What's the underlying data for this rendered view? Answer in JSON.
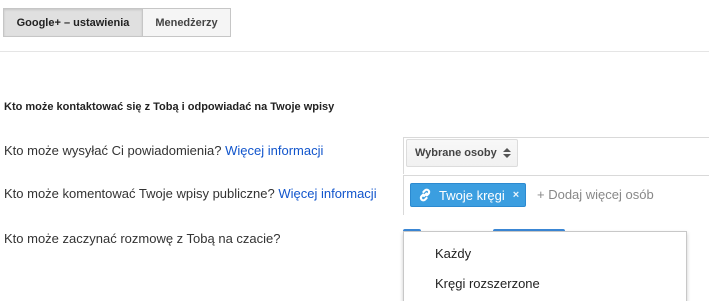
{
  "tabs": [
    {
      "label": "Google+ – ustawienia",
      "active": true
    },
    {
      "label": "Menedżerzy",
      "active": false
    }
  ],
  "section": {
    "title": "Kto może kontaktować się z Tobą i odpowiadać na Twoje wpisy"
  },
  "rows": [
    {
      "label": "Kto może wysyłać Ci powiadomienia? ",
      "link": "Więcej informacji"
    },
    {
      "label": "Kto może komentować Twoje wpisy publiczne? ",
      "link": "Więcej informacji"
    },
    {
      "label": "Kto może zaczynać rozmowę z Tobą na czacie?"
    }
  ],
  "notifications_select": {
    "value": "Wybrane osoby",
    "icon": "up-down-arrows-icon"
  },
  "comments": {
    "chip_label": "Twoje kręgi",
    "chip_icon": "link-icon",
    "chip_remove": "×",
    "add_placeholder": "+ Dodaj więcej osób"
  },
  "chat_dropdown": {
    "options": [
      "Każdy",
      "Kręgi rozszerzone"
    ]
  },
  "colors": {
    "link": "#1155cc",
    "chip": "#3b9ee0",
    "accent_button": "#3b88d6"
  }
}
